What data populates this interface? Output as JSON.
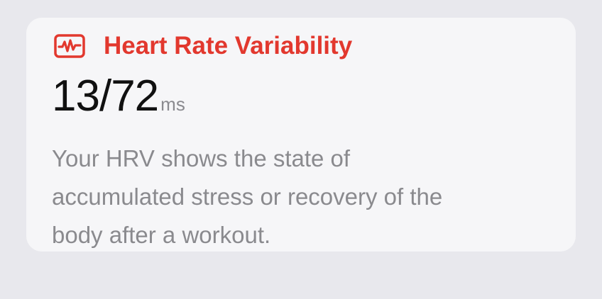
{
  "card": {
    "icon": "waveform-icon",
    "title": "Heart Rate Variability",
    "value": "13/72",
    "unit": "ms",
    "description_lines": [
      "Your HRV shows the state of",
      "accumulated stress or recovery of the",
      "body after a workout."
    ]
  },
  "colors": {
    "accent": "#e2382e",
    "background": "#e8e8ed",
    "card": "#f6f6f8",
    "value_text": "#111111",
    "secondary_text": "#8a8a8e"
  }
}
